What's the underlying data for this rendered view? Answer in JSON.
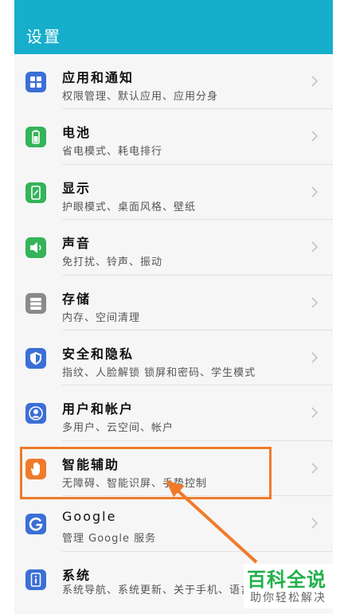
{
  "header": {
    "title": "设置"
  },
  "settings": [
    {
      "title": "应用和通知",
      "subtitle": "权限管理、默认应用、应用分身",
      "icon": "apps-grid-icon",
      "color": "#3b6fd6"
    },
    {
      "title": "电池",
      "subtitle": "省电模式、耗电排行",
      "icon": "battery-icon",
      "color": "#34b35a"
    },
    {
      "title": "显示",
      "subtitle": "护眼模式、桌面风格、壁纸",
      "icon": "display-icon",
      "color": "#34b35a"
    },
    {
      "title": "声音",
      "subtitle": "免打扰、铃声、振动",
      "icon": "speaker-icon",
      "color": "#34b35a"
    },
    {
      "title": "存储",
      "subtitle": "内存、空间清理",
      "icon": "storage-icon",
      "color": "#8a8a8a"
    },
    {
      "title": "安全和隐私",
      "subtitle": "指纹、人脸解锁 锁屏和密码、学生模式",
      "icon": "shield-icon",
      "color": "#3b6fd6"
    },
    {
      "title": "用户和帐户",
      "subtitle": "多用户、云空间、帐户",
      "icon": "user-icon",
      "color": "#3b6fd6"
    },
    {
      "title": "智能辅助",
      "subtitle": "无障碍、智能识屏、手势控制",
      "icon": "hand-icon",
      "color": "#f07a2a"
    },
    {
      "title": "Google",
      "subtitle": "管理 Google 服务",
      "icon": "google-icon",
      "color": "#3b6fd6"
    },
    {
      "title": "系统",
      "subtitle": "系统导航、系统更新、关于手机、语言和输入法",
      "icon": "system-info-icon",
      "color": "#3b6fd6"
    }
  ],
  "watermark": {
    "line1": "百科全说",
    "line2": "助你轻松解决"
  },
  "colors": {
    "accent": "#16aecb",
    "highlight": "#f07a2a",
    "watermark": "#21b04a"
  }
}
